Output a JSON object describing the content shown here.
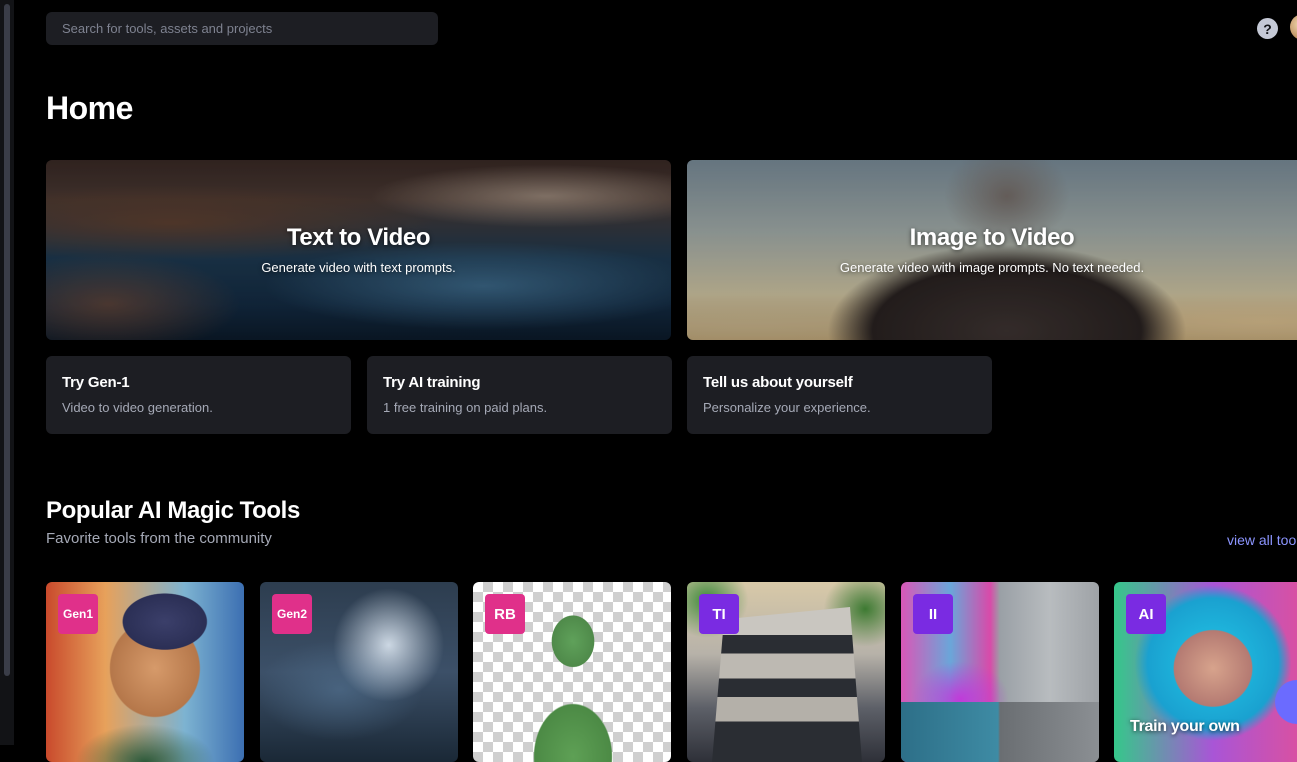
{
  "search": {
    "placeholder": "Search for tools, assets and projects"
  },
  "header": {
    "help_label": "?"
  },
  "page": {
    "title": "Home"
  },
  "heroes": [
    {
      "title": "Text to Video",
      "subtitle": "Generate video with text prompts."
    },
    {
      "title": "Image to Video",
      "subtitle": "Generate video with image prompts. No text needed."
    }
  ],
  "cards": [
    {
      "title": "Try Gen-1",
      "subtitle": "Video to video generation."
    },
    {
      "title": "Try AI training",
      "subtitle": "1 free training on paid plans."
    },
    {
      "title": "Tell us about yourself",
      "subtitle": "Personalize your experience."
    }
  ],
  "popular": {
    "title": "Popular AI Magic Tools",
    "subtitle": "Favorite tools from the community",
    "view_all": "view all tools"
  },
  "tools": [
    {
      "badge": "Gen1",
      "badge_color": "#e0308a"
    },
    {
      "badge": "Gen2",
      "badge_color": "#e0308a"
    },
    {
      "badge": "RB",
      "badge_color": "#e0308a"
    },
    {
      "badge": "TI",
      "badge_color": "#7a2be2"
    },
    {
      "badge": "II",
      "badge_color": "#7a2be2"
    },
    {
      "badge": "AI",
      "badge_color": "#7a2be2",
      "label": "Train your own"
    }
  ],
  "colors": {
    "accent_link": "#8c95ff",
    "card_bg": "#1d1e23",
    "page_bg": "#000000"
  }
}
